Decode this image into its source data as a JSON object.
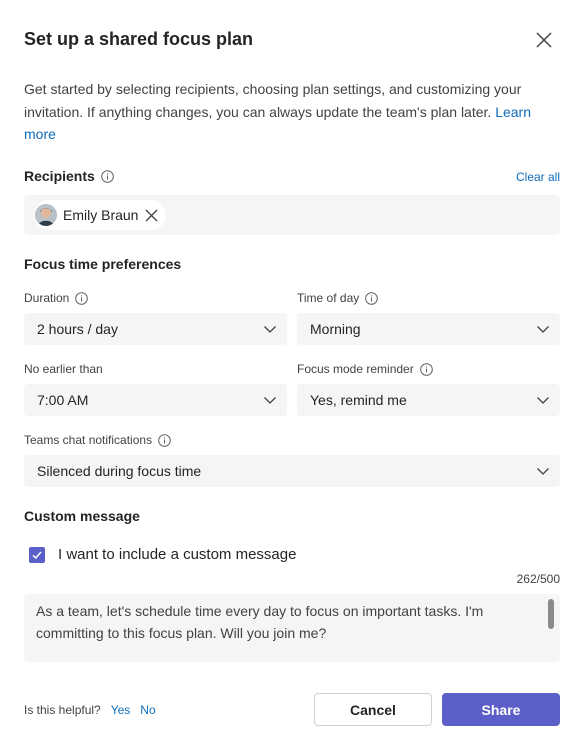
{
  "dialog": {
    "title": "Set up a shared focus plan",
    "intro_text": "Get started by selecting recipients, choosing plan settings, and customizing your invitation. If anything changes, you can always update the team's plan later.",
    "intro_link": "Learn more"
  },
  "recipients": {
    "label": "Recipients",
    "clear_all": "Clear all",
    "chips": [
      {
        "name": "Emily Braun"
      }
    ]
  },
  "preferences": {
    "heading": "Focus time preferences",
    "duration": {
      "label": "Duration",
      "value": "2 hours / day"
    },
    "time_of_day": {
      "label": "Time of day",
      "value": "Morning"
    },
    "no_earlier_than": {
      "label": "No earlier than",
      "value": "7:00 AM"
    },
    "focus_mode_reminder": {
      "label": "Focus mode reminder",
      "value": "Yes, remind me"
    },
    "teams_chat_notifications": {
      "label": "Teams chat notifications",
      "value": "Silenced during focus time"
    }
  },
  "custom_message": {
    "heading": "Custom message",
    "checkbox_label": "I want to include a custom message",
    "checked": true,
    "counter": "262/500",
    "text": "As a team, let's schedule time every day to focus on important tasks. I'm committing to this focus plan. Will you join me?"
  },
  "footer": {
    "helpful_prompt": "Is this helpful?",
    "yes": "Yes",
    "no": "No",
    "cancel_label": "Cancel",
    "share_label": "Share"
  },
  "colors": {
    "accent": "#5b5fc7",
    "link": "#0f6cbd",
    "field_bg": "#f5f5f5"
  },
  "icons": [
    "close-icon",
    "info-icon",
    "chevron-down-icon",
    "checkmark-icon",
    "dismiss-icon"
  ]
}
